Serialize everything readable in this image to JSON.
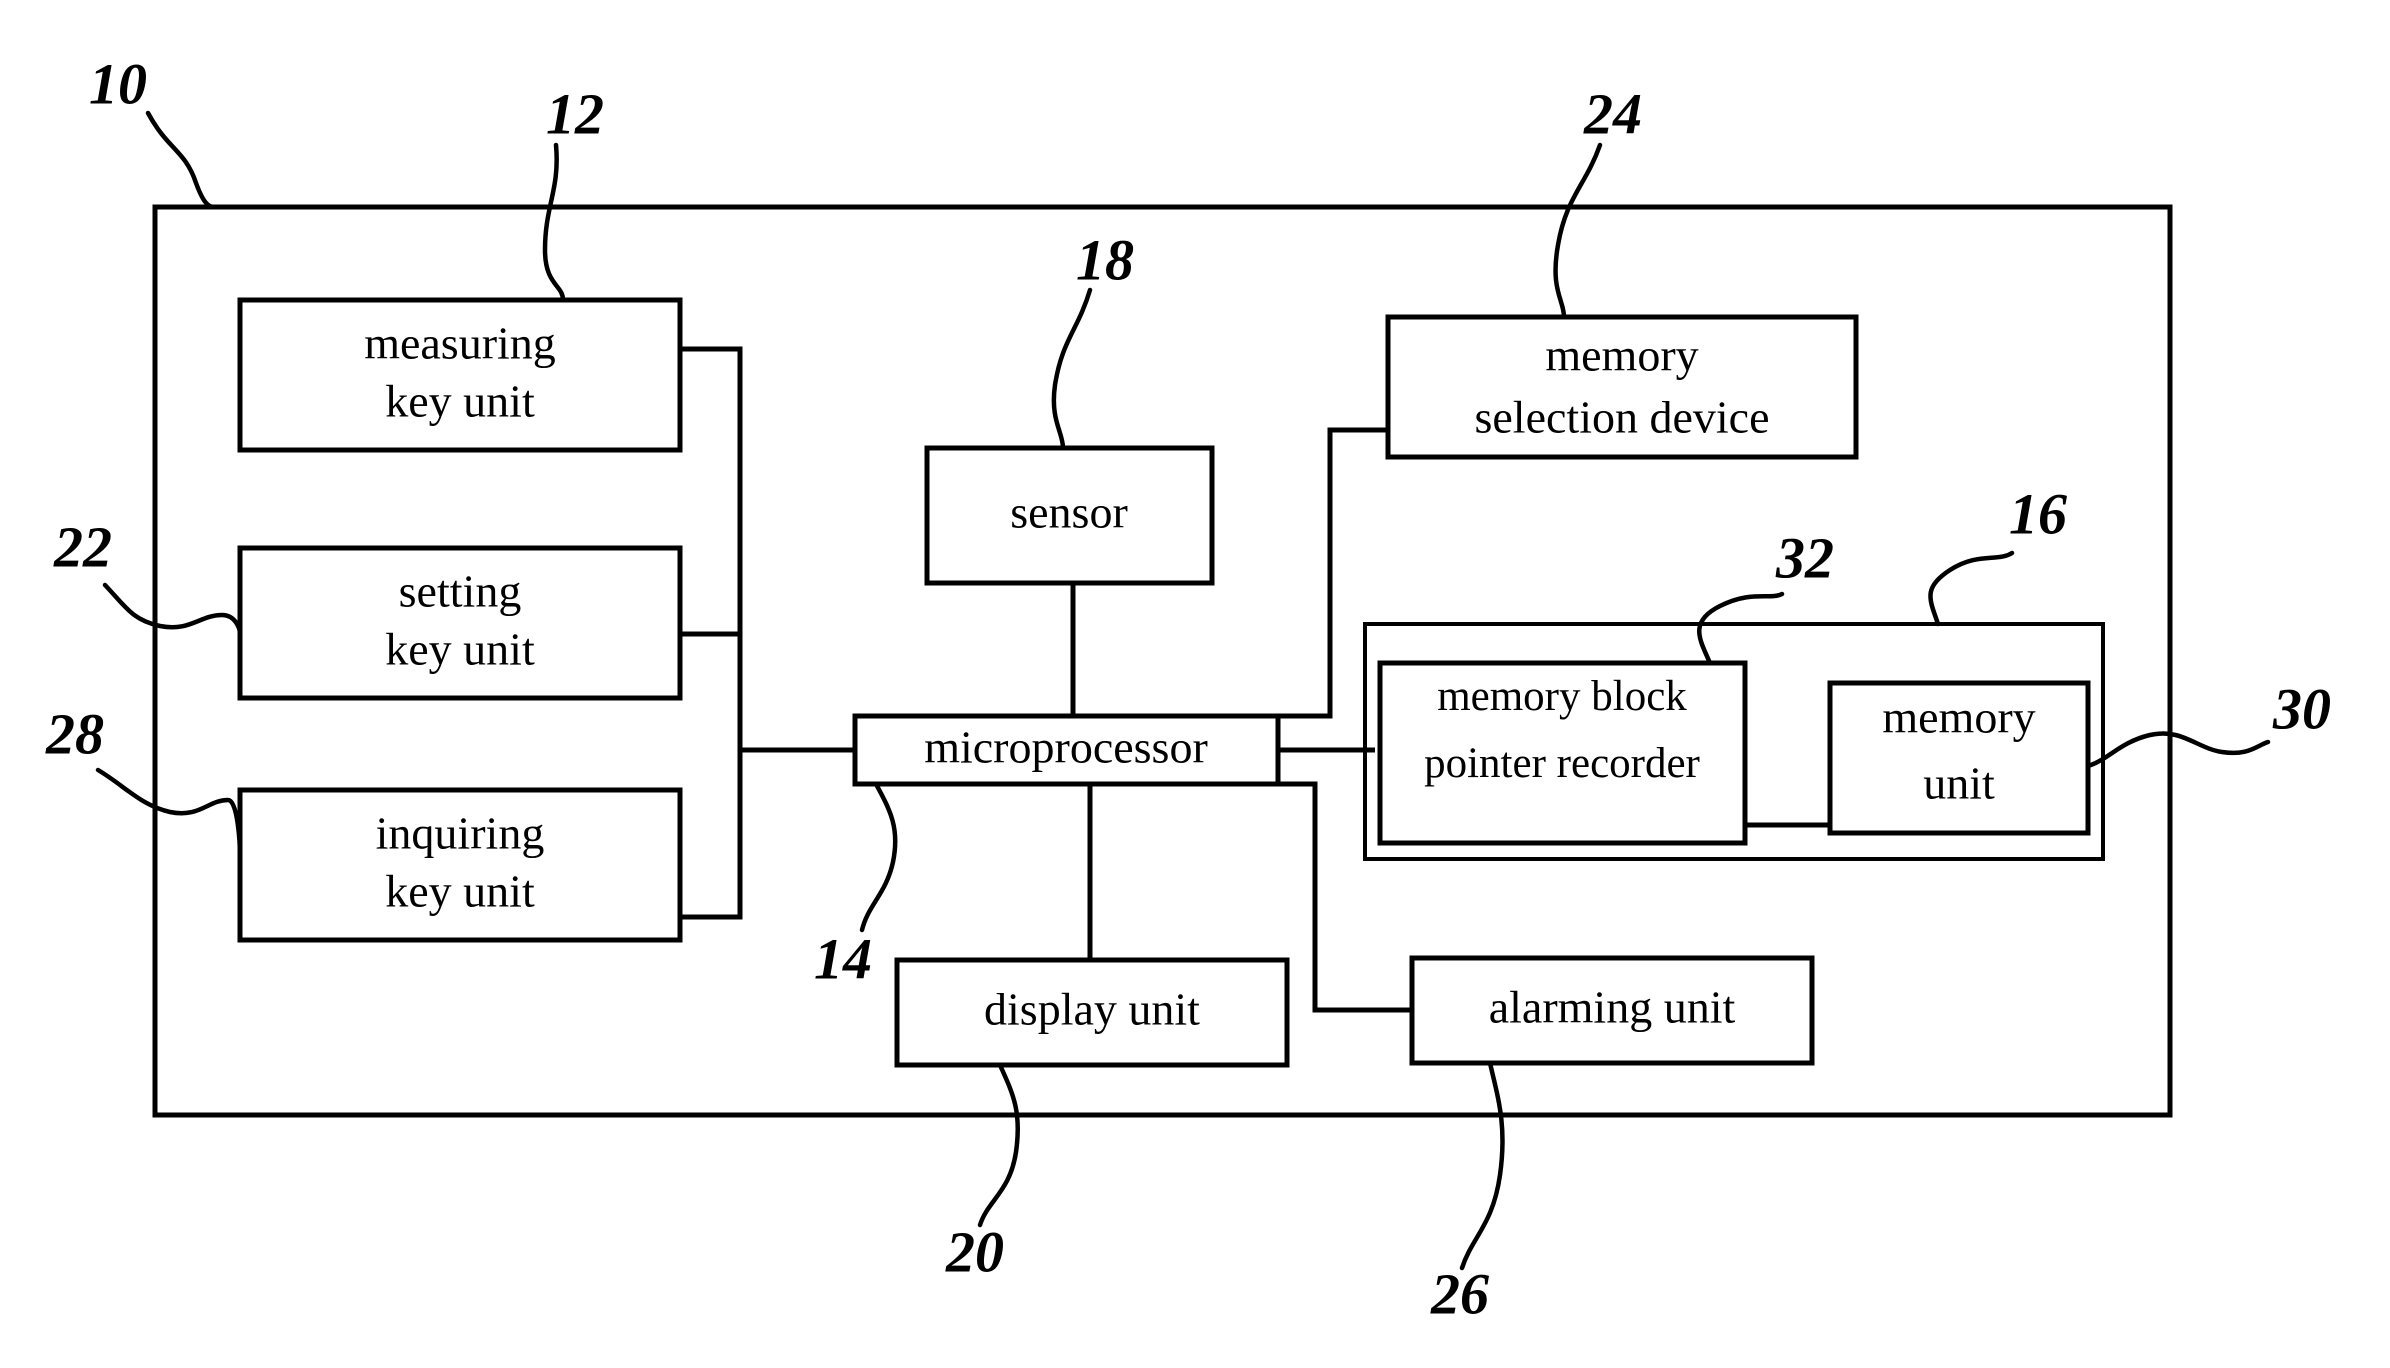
{
  "figure": {
    "type": "patent-block-diagram",
    "background_color": "#ffffff",
    "line_color": "#000000"
  },
  "outer_container": {
    "ref": "10",
    "name": "apparatus-enclosure"
  },
  "blocks": {
    "measuring_key_unit": {
      "line1": "measuring",
      "line2": "key unit",
      "ref": "12"
    },
    "setting_key_unit": {
      "line1": "setting",
      "line2": "key unit",
      "ref": "22"
    },
    "inquiring_key_unit": {
      "line1": "inquiring",
      "line2": "key unit",
      "ref": "28"
    },
    "sensor": {
      "line1": "sensor",
      "ref": "18"
    },
    "microprocessor": {
      "line1": "microprocessor",
      "ref": "14"
    },
    "display_unit": {
      "line1": "display unit",
      "ref": "20"
    },
    "alarming_unit": {
      "line1": "alarming unit",
      "ref": "26"
    },
    "memory_selection_device": {
      "line1": "memory",
      "line2": "selection device",
      "ref": "24"
    },
    "memory_block_pointer_recorder": {
      "line1": "memory block",
      "line2": "pointer recorder",
      "ref": "32"
    },
    "memory_unit": {
      "line1": "memory",
      "line2": "unit",
      "ref": "30"
    },
    "memory_group": {
      "ref": "16",
      "name": "memory-device-group"
    }
  },
  "reference_numerals": {
    "n10": "10",
    "n12": "12",
    "n14": "14",
    "n16": "16",
    "n18": "18",
    "n20": "20",
    "n22": "22",
    "n24": "24",
    "n26": "26",
    "n28": "28",
    "n30": "30",
    "n32": "32"
  }
}
